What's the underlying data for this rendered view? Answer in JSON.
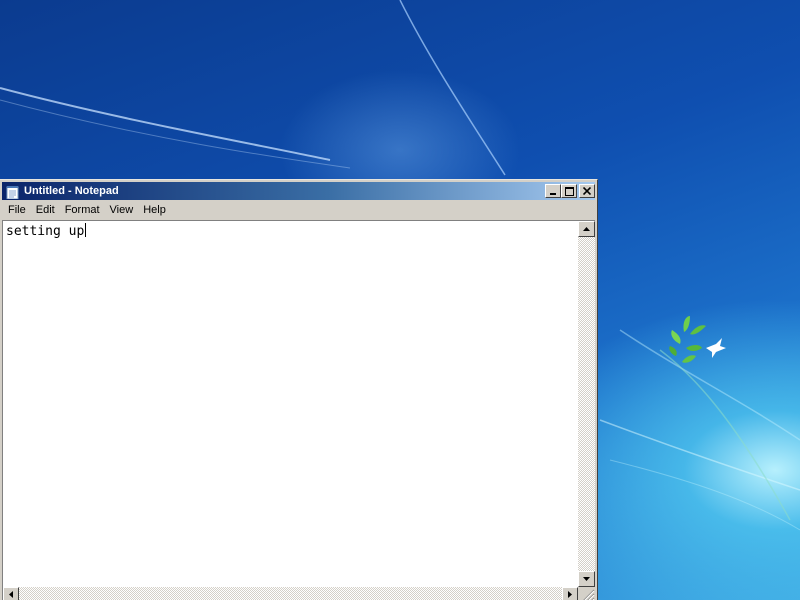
{
  "window": {
    "title": "Untitled - Notepad",
    "title_gradient": [
      "#0a246a",
      "#a6caf0"
    ]
  },
  "menu": {
    "items": [
      "File",
      "Edit",
      "Format",
      "View",
      "Help"
    ]
  },
  "editor": {
    "text": "setting up"
  },
  "icons": {
    "app": "notepad-icon",
    "minimize": "minimize-icon",
    "maximize": "maximize-icon",
    "close": "close-icon"
  },
  "desktop": {
    "background_colors": [
      "#0b3b8f",
      "#1d73cc",
      "#3ea8e3"
    ],
    "logo": "windows-7-bird-leaf-logo"
  }
}
